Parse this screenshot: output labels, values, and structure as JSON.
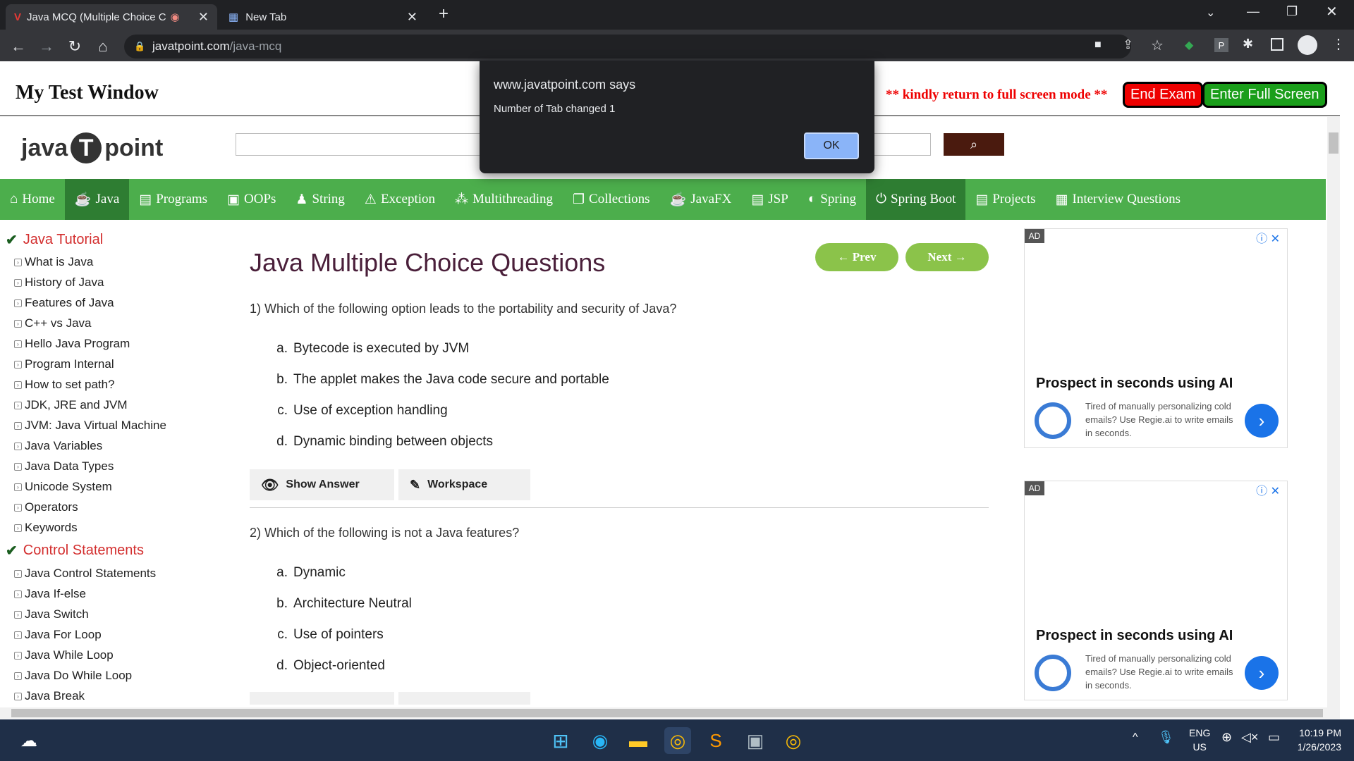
{
  "browser": {
    "tabs": [
      {
        "title": "Java MCQ (Multiple Choice C",
        "active": true
      },
      {
        "title": "New Tab",
        "active": false
      }
    ],
    "url_host": "javatpoint.com",
    "url_path": "/java-mcq"
  },
  "test_header": {
    "title": "My Test Window",
    "warning": "** kindly return to full screen mode **",
    "end_exam": "End Exam",
    "full_screen": "Enter Full Screen"
  },
  "dialog": {
    "title": "www.javatpoint.com says",
    "message": "Number of Tab changed 1",
    "ok": "OK"
  },
  "site": {
    "logo_java": "java",
    "logo_point": "point",
    "nav": [
      "Home",
      "Java",
      "Programs",
      "OOPs",
      "String",
      "Exception",
      "Multithreading",
      "Collections",
      "JavaFX",
      "JSP",
      "Spring",
      "Spring Boot",
      "Projects",
      "Interview Questions"
    ]
  },
  "sidebar": {
    "section1": "Java Tutorial",
    "items1": [
      "What is Java",
      "History of Java",
      "Features of Java",
      "C++ vs Java",
      "Hello Java Program",
      "Program Internal",
      "How to set path?",
      "JDK, JRE and JVM",
      "JVM: Java Virtual Machine",
      "Java Variables",
      "Java Data Types",
      "Unicode System",
      "Operators",
      "Keywords"
    ],
    "section2": "Control Statements",
    "items2": [
      "Java Control Statements",
      "Java If-else",
      "Java Switch",
      "Java For Loop",
      "Java While Loop",
      "Java Do While Loop",
      "Java Break"
    ]
  },
  "main": {
    "heading": "Java Multiple Choice Questions",
    "prev": "← Prev",
    "next": "Next →",
    "q1": "1) Which of the following option leads to the portability and security of Java?",
    "q1_opts": [
      {
        "l": "a.",
        "t": "Bytecode is executed by JVM"
      },
      {
        "l": "b.",
        "t": "The applet makes the Java code secure and portable"
      },
      {
        "l": "c.",
        "t": "Use of exception handling"
      },
      {
        "l": "d.",
        "t": "Dynamic binding between objects"
      }
    ],
    "show_answer": "Show Answer",
    "workspace": "Workspace",
    "q2": "2) Which of the following is not a Java features?",
    "q2_opts": [
      {
        "l": "a.",
        "t": "Dynamic"
      },
      {
        "l": "b.",
        "t": "Architecture Neutral"
      },
      {
        "l": "c.",
        "t": "Use of pointers"
      },
      {
        "l": "d.",
        "t": "Object-oriented"
      }
    ]
  },
  "ads": [
    {
      "badge": "AD",
      "title": "Prospect in seconds using AI",
      "text": "Tired of manually personalizing cold emails? Use Regie.ai to write emails in seconds."
    },
    {
      "badge": "AD",
      "title": "Prospect in seconds using AI",
      "text": "Tired of manually personalizing cold emails? Use Regie.ai to write emails in seconds."
    }
  ],
  "taskbar": {
    "lang1": "ENG",
    "lang2": "US",
    "time": "10:19 PM",
    "date": "1/26/2023"
  }
}
